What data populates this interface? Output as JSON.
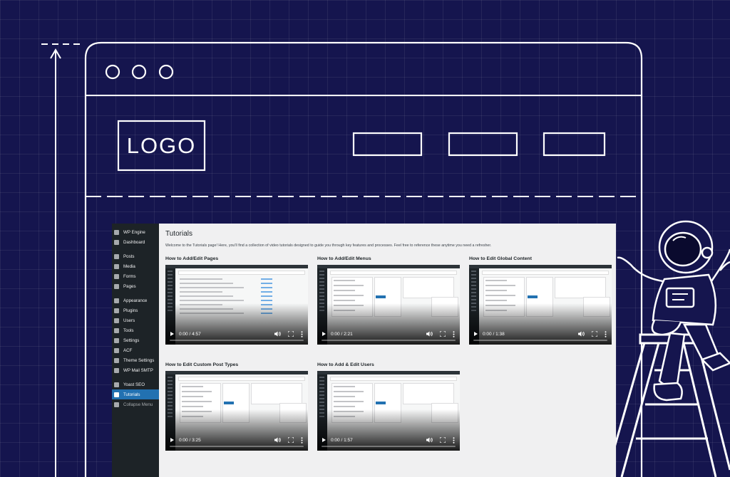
{
  "mockup": {
    "logo_text": "LOGO"
  },
  "admin": {
    "sidebar": {
      "items": [
        {
          "label": "WP Engine",
          "icon": "wp-engine-icon"
        },
        {
          "label": "Dashboard",
          "icon": "dashboard-icon"
        },
        {
          "label": "Posts",
          "icon": "pin-icon"
        },
        {
          "label": "Media",
          "icon": "media-icon"
        },
        {
          "label": "Forms",
          "icon": "forms-icon"
        },
        {
          "label": "Pages",
          "icon": "pages-icon"
        },
        {
          "label": "Appearance",
          "icon": "brush-icon"
        },
        {
          "label": "Plugins",
          "icon": "plug-icon"
        },
        {
          "label": "Users",
          "icon": "user-icon"
        },
        {
          "label": "Tools",
          "icon": "wrench-icon"
        },
        {
          "label": "Settings",
          "icon": "settings-icon"
        },
        {
          "label": "ACF",
          "icon": "acf-icon"
        },
        {
          "label": "Theme Settings",
          "icon": "gear-icon"
        },
        {
          "label": "WP Mail SMTP",
          "icon": "mail-icon"
        },
        {
          "label": "Yoast SEO",
          "icon": "yoast-icon"
        },
        {
          "label": "Tutorials",
          "icon": "graduation-cap-icon"
        },
        {
          "label": "Collapse Menu",
          "icon": "collapse-icon"
        }
      ],
      "active_index": 15
    },
    "page_title": "Tutorials",
    "intro": "Welcome to the Tutorials page! Here, you'll find a collection of video tutorials designed to guide you through key features and processes. Feel free to reference these anytime you need a refresher.",
    "tutorials": [
      {
        "title": "How to Add/Edit Pages",
        "time": "0:00 / 4:57"
      },
      {
        "title": "How to Add/Edit Menus",
        "time": "0:00 / 2:21"
      },
      {
        "title": "How to Edit Global Content",
        "time": "0:00 / 1:38"
      },
      {
        "title": "How to Edit Custom Post Types",
        "time": "0:00 / 3:25"
      },
      {
        "title": "How to Add & Edit Users",
        "time": "0:00 / 1:57"
      }
    ]
  },
  "colors": {
    "background": "#15154e",
    "admin_sidebar": "#1d2327",
    "admin_accent": "#2271b1",
    "admin_content": "#f0f0f1"
  }
}
